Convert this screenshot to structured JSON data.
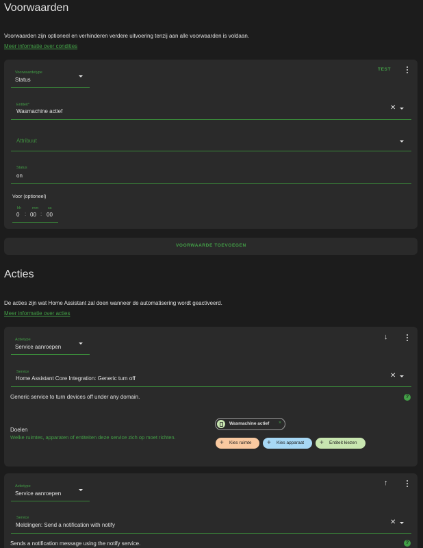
{
  "conditions": {
    "title": "Voorwaarden",
    "description": "Voorwaarden zijn optioneel en verhinderen verdere uitvoering tenzij aan alle voorwaarden is voldaan.",
    "learn_more": "Meer informatie over condities",
    "card": {
      "type_label": "Voorwaardetype",
      "type_value": "Status",
      "test_label": "TEST",
      "entity_label": "Entiteit*",
      "entity_value": "Wasmachine actief",
      "attribute_placeholder": "Attribuut",
      "state_label": "Status",
      "state_value": "on",
      "for_label": "Voor (optioneel)",
      "duration": {
        "h_label": "hh",
        "h_value": "0",
        "m_label": "mm",
        "m_value": "00",
        "s_label": "ss",
        "s_value": "00"
      }
    },
    "add_button": "VOORWAARDE TOEVOEGEN"
  },
  "actions": {
    "title": "Acties",
    "description": "De acties zijn wat Home Assistant zal doen wanneer de automatisering wordt geactiveerd.",
    "learn_more": "Meer informatie over acties",
    "card1": {
      "type_label": "Actietype",
      "type_value": "Service aanroepen",
      "service_label": "Service",
      "service_value": "Home Assistant Core Integration: Generic turn off",
      "service_description": "Generic service to turn devices off under any domain.",
      "targets_title": "Doelen",
      "targets_description": "Welke ruimtes, apparaten of entiteiten deze service zich op moet richten.",
      "target_chip": "Wasmachine actief",
      "chips": {
        "area": "Kies ruimte",
        "device": "Kies apparaat",
        "entity": "Entiteit kiezen"
      }
    },
    "card2": {
      "type_label": "Actietype",
      "type_value": "Service aanroepen",
      "service_label": "Service",
      "service_value": "Meldingen: Send a notification with notify",
      "service_description": "Sends a notification message using the notify service."
    }
  },
  "colors": {
    "background": "#1c1c1c",
    "card": "#2a2a2a",
    "accent": "#43a047",
    "chip_area": "#f9c9a0",
    "chip_device": "#a7d8f5",
    "chip_entity": "#c8e6b0"
  },
  "icons": {
    "menu": "dots-vertical-icon",
    "clear": "close-icon",
    "dropdown": "menu-down-icon",
    "move_down": "arrow-down-icon",
    "move_up": "arrow-up-icon",
    "help": "help-circle-icon",
    "add": "plus-icon",
    "entity": "clipboard-icon"
  }
}
